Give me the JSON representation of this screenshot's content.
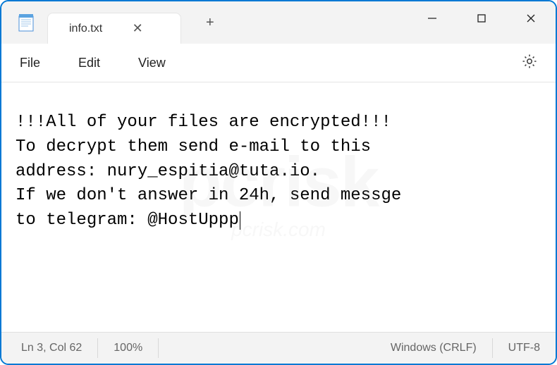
{
  "tab": {
    "title": "info.txt"
  },
  "menus": {
    "file": "File",
    "edit": "Edit",
    "view": "View"
  },
  "content": {
    "line1": "!!!All of your files are encrypted!!!",
    "line2": "To decrypt them send e-mail to this",
    "line3": "address: nury_espitia@tuta.io.",
    "line4": "If we don't answer in 24h, send messge",
    "line5": "to telegram: @HostUppp"
  },
  "status": {
    "position": "Ln 3, Col 62",
    "zoom": "100%",
    "line_ending": "Windows (CRLF)",
    "encoding": "UTF-8"
  },
  "watermark": {
    "main": "pcrisk",
    "sub": "pcrisk.com"
  }
}
